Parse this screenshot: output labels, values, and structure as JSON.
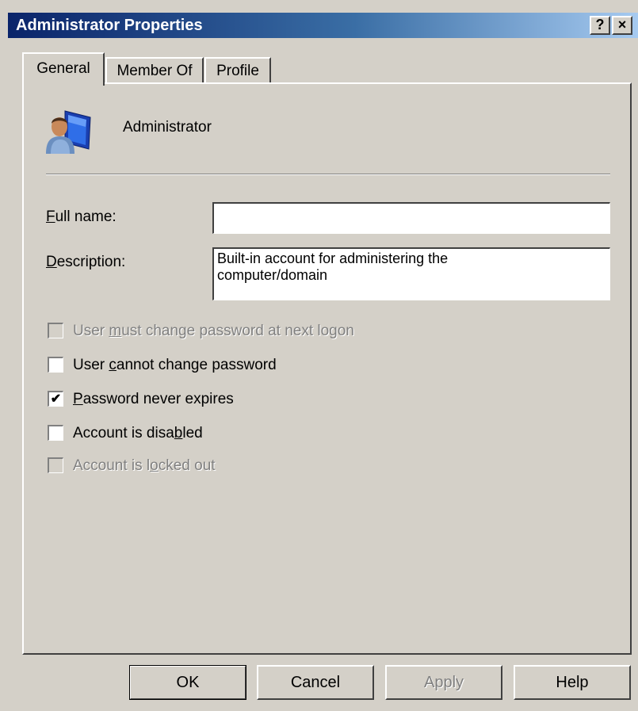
{
  "window": {
    "title": "Administrator Properties",
    "help_button": "?",
    "close_button": "×"
  },
  "tabs": [
    {
      "label": "General",
      "active": true
    },
    {
      "label": "Member Of",
      "active": false
    },
    {
      "label": "Profile",
      "active": false
    }
  ],
  "general": {
    "user_icon": "user-computer-icon",
    "username": "Administrator",
    "full_name": {
      "label_mnemonic": "F",
      "label_rest": "ull name:",
      "value": ""
    },
    "description": {
      "label_mnemonic": "D",
      "label_rest": "escription:",
      "value": "Built-in account for administering the\ncomputer/domain"
    },
    "checkboxes": [
      {
        "pre": "User ",
        "mnemonic": "m",
        "post": "ust change password at next logon",
        "checked": false,
        "enabled": false
      },
      {
        "pre": "User ",
        "mnemonic": "c",
        "post": "annot change password",
        "checked": false,
        "enabled": true
      },
      {
        "pre": "",
        "mnemonic": "P",
        "post": "assword never expires",
        "checked": true,
        "enabled": true
      },
      {
        "pre": "Account is disa",
        "mnemonic": "b",
        "post": "led",
        "checked": false,
        "enabled": true
      },
      {
        "pre": "Account is l",
        "mnemonic": "o",
        "post": "cked out",
        "checked": false,
        "enabled": false
      }
    ]
  },
  "buttons": {
    "ok": "OK",
    "cancel": "Cancel",
    "apply": "Apply",
    "help": "Help"
  }
}
